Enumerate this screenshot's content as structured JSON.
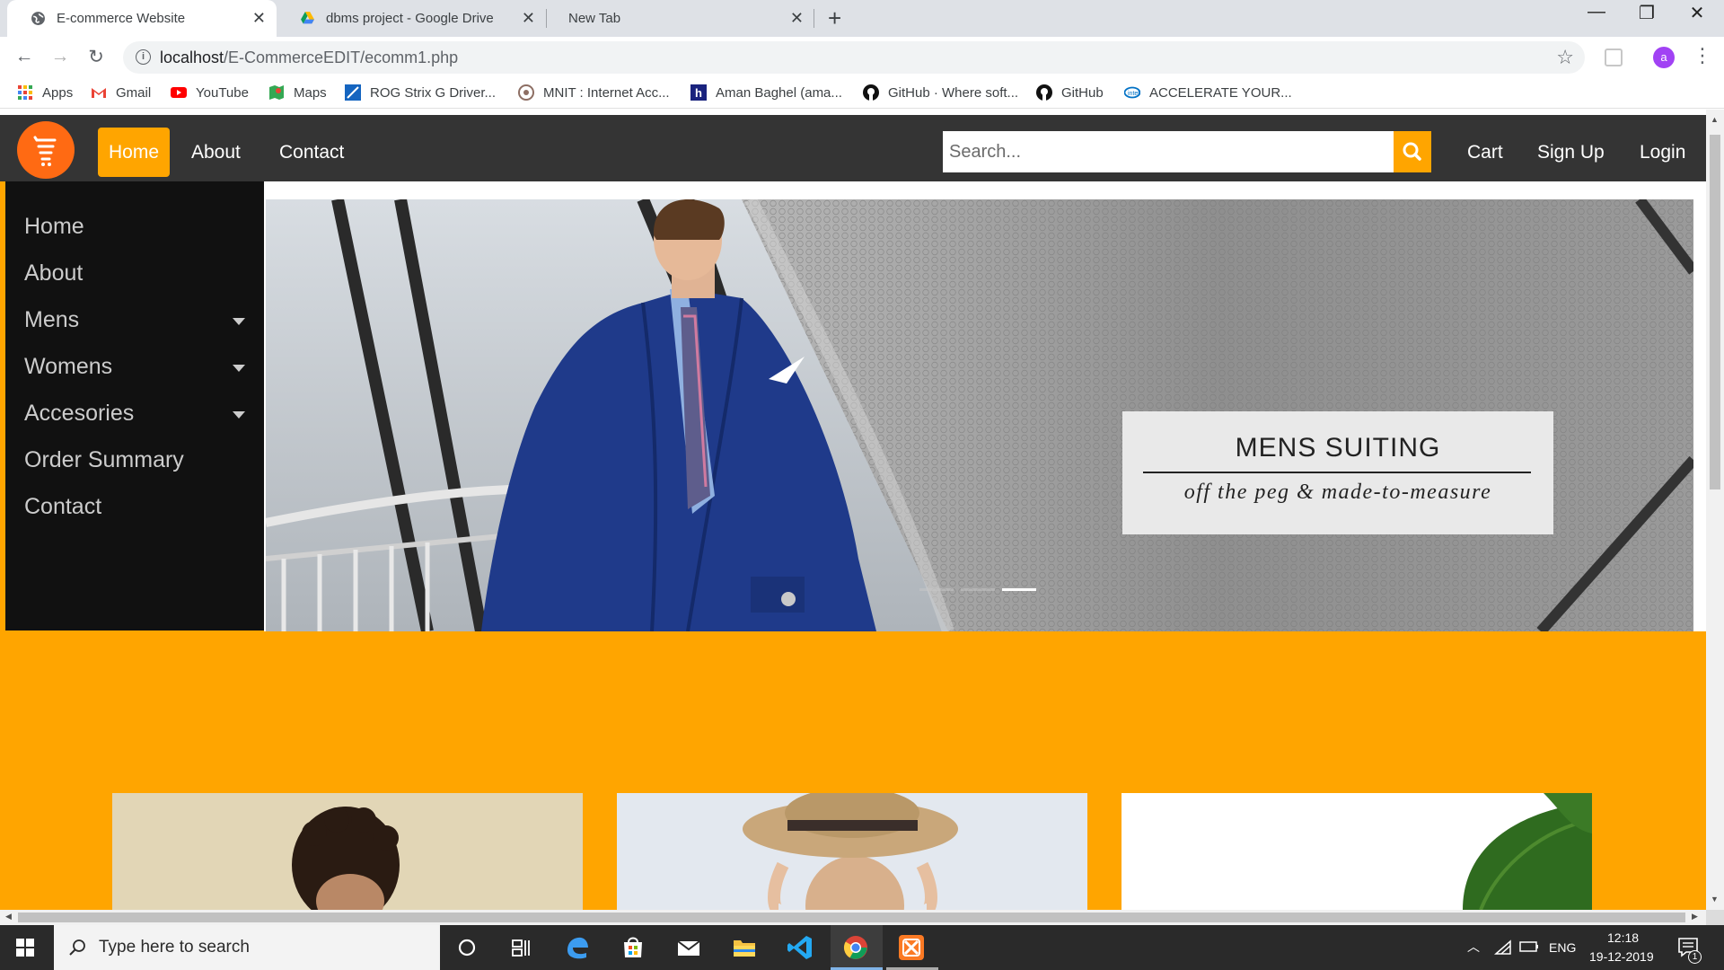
{
  "browser": {
    "tabs": [
      {
        "title": "E-commerce Website",
        "active": true,
        "icon": "globe-icon"
      },
      {
        "title": "dbms project - Google Drive",
        "active": false,
        "icon": "google-drive-icon"
      },
      {
        "title": "New Tab",
        "active": false,
        "icon": "none"
      }
    ],
    "url_host": "localhost",
    "url_path": "/E-CommerceEDIT/ecomm1.php",
    "profile_initial": "a",
    "bookmarks": [
      {
        "label": "Apps",
        "icon": "apps-grid-icon"
      },
      {
        "label": "Gmail",
        "icon": "gmail-icon"
      },
      {
        "label": "YouTube",
        "icon": "youtube-icon"
      },
      {
        "label": "Maps",
        "icon": "maps-icon"
      },
      {
        "label": "ROG Strix G Driver...",
        "icon": "rog-icon"
      },
      {
        "label": "MNIT : Internet Acc...",
        "icon": "mnit-icon"
      },
      {
        "label": "Aman Baghel (ama...",
        "icon": "hashnode-icon"
      },
      {
        "label": "GitHub · Where soft...",
        "icon": "github-icon"
      },
      {
        "label": "GitHub",
        "icon": "github-icon"
      },
      {
        "label": "ACCELERATE YOUR...",
        "icon": "intel-icon"
      }
    ]
  },
  "site": {
    "nav": {
      "left": [
        "Home",
        "About",
        "Contact"
      ],
      "active": "Home",
      "search_placeholder": "Search...",
      "right": [
        "Cart",
        "Sign Up",
        "Login"
      ]
    },
    "sidebar": [
      {
        "label": "Home",
        "dropdown": false
      },
      {
        "label": "About",
        "dropdown": false
      },
      {
        "label": "Mens",
        "dropdown": true
      },
      {
        "label": "Womens",
        "dropdown": true
      },
      {
        "label": "Accesories",
        "dropdown": true
      },
      {
        "label": "Order Summary",
        "dropdown": false
      },
      {
        "label": "Contact",
        "dropdown": false
      }
    ],
    "hero": {
      "title": "MENS SUITING",
      "subtitle": "off the peg & made-to-measure"
    },
    "colors": {
      "accent": "#ffa500",
      "logo": "#ff6a13",
      "navbar": "#343434",
      "sidebar": "#111111"
    }
  },
  "taskbar": {
    "search_placeholder": "Type here to search",
    "language": "ENG",
    "time": "12:18",
    "date": "19-12-2019",
    "notification_count": "1"
  }
}
